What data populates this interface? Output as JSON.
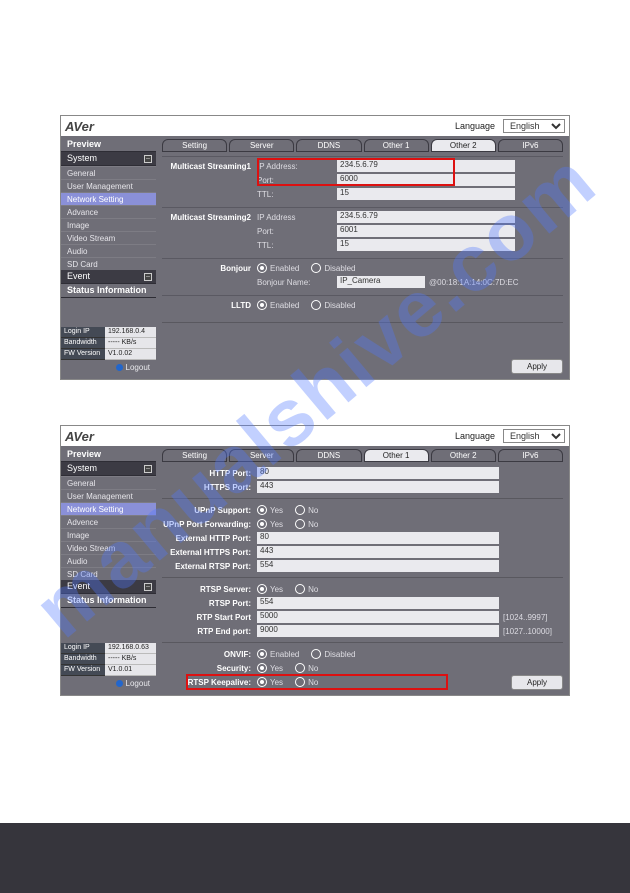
{
  "watermark": "manualshive.com",
  "logo": "AVer",
  "langLabel": "Language",
  "langValue": "English",
  "apply": "Apply",
  "logout": "Logout",
  "shot1": {
    "sections": {
      "preview": "Preview",
      "system": "System",
      "event": "Event",
      "status": "Status Information"
    },
    "nav": [
      "General",
      "User Management",
      "Network Setting",
      "Advance",
      "Image",
      "Video Stream",
      "Audio",
      "SD Card"
    ],
    "tabs": [
      "Setting",
      "Server",
      "DDNS",
      "Other 1",
      "Other 2",
      "IPv6"
    ],
    "activeTab": "Other 2",
    "groups": {
      "mc1": {
        "title": "Multicast Streaming1",
        "ip": {
          "label": "IP Address:",
          "value": "234.5.6.79"
        },
        "port": {
          "label": "Port:",
          "value": "6000"
        },
        "ttl": {
          "label": "TTL:",
          "value": "15"
        }
      },
      "mc2": {
        "title": "Multicast Streaming2",
        "ip": {
          "label": "IP Address",
          "value": "234.5.6.79"
        },
        "port": {
          "label": "Port:",
          "value": "6001"
        },
        "ttl": {
          "label": "TTL:",
          "value": "15"
        }
      },
      "bonjour": {
        "title": "Bonjour",
        "enabled": "Enabled",
        "disabled": "Disabled",
        "nameLabel": "Bonjour Name:",
        "nameValue": "IP_Camera",
        "mac": "@00:18:1A:14:0C:7D:EC"
      },
      "lltd": {
        "title": "LLTD",
        "enabled": "Enabled",
        "disabled": "Disabled"
      }
    },
    "info": {
      "ipLabel": "Login IP",
      "ip": "192.168.0.4",
      "bwLabel": "Bandwidth",
      "bw": "----- KB/s",
      "fwLabel": "FW Version",
      "fw": "V1.0.02"
    }
  },
  "shot2": {
    "sections": {
      "preview": "Preview",
      "system": "System",
      "event": "Event",
      "status": "Status Information"
    },
    "nav": [
      "General",
      "User Management",
      "Network Setting",
      "Advence",
      "Image",
      "Video Stream",
      "Audio",
      "SD Card"
    ],
    "tabs": [
      "Setting",
      "Server",
      "DDNS",
      "Other 1",
      "Other 2",
      "IPv6"
    ],
    "activeTab": "Other 1",
    "rows": {
      "httpPort": {
        "label": "HTTP Port:",
        "value": "80"
      },
      "httpsPort": {
        "label": "HTTPS Port:",
        "value": "443"
      },
      "upnp": {
        "label": "UPnP Support:",
        "yes": "Yes",
        "no": "No"
      },
      "upnpFwd": {
        "label": "UPnP Port Forwarding:",
        "yes": "Yes",
        "no": "No"
      },
      "extHttp": {
        "label": "External HTTP Port:",
        "value": "80"
      },
      "extHttps": {
        "label": "External HTTPS Port:",
        "value": "443"
      },
      "extRtsp": {
        "label": "External RTSP Port:",
        "value": "554"
      },
      "rtspServer": {
        "label": "RTSP Server:",
        "yes": "Yes",
        "no": "No"
      },
      "rtspPort": {
        "label": "RTSP Port:",
        "value": "554"
      },
      "rtpStart": {
        "label": "RTP Start Port",
        "value": "5000",
        "range": "[1024..9997]"
      },
      "rtpEnd": {
        "label": "RTP End port:",
        "value": "9000",
        "range": "[1027..10000]"
      },
      "onvif": {
        "label": "ONVIF:",
        "enabled": "Enabled",
        "disabled": "Disabled"
      },
      "security": {
        "label": "Security:",
        "yes": "Yes",
        "no": "No"
      },
      "keepalive": {
        "label": "RTSP Keepalive:",
        "yes": "Yes",
        "no": "No"
      }
    },
    "info": {
      "ipLabel": "Login IP",
      "ip": "192.168.0.63",
      "bwLabel": "Bandwidth",
      "bw": "----- KB/s",
      "fwLabel": "FW Version",
      "fw": "V1.0.01"
    }
  }
}
